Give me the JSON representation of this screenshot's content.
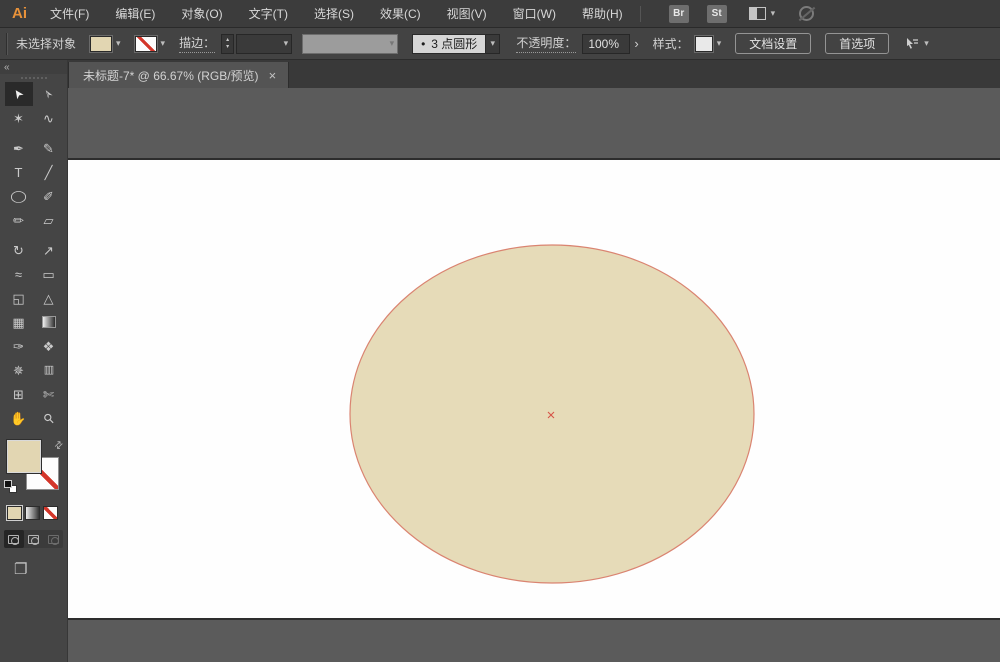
{
  "menu_bar": {
    "logo": "Ai",
    "items": [
      "文件(F)",
      "编辑(E)",
      "对象(O)",
      "文字(T)",
      "选择(S)",
      "效果(C)",
      "视图(V)",
      "窗口(W)",
      "帮助(H)"
    ],
    "bridge": "Br",
    "stock": "St"
  },
  "control_bar": {
    "status": "未选择对象",
    "fill_color": "#e2d6b2",
    "stroke_color": "none",
    "stroke_label": "描边：",
    "brush_bullet": "•",
    "brush_name": "3 点圆形",
    "opacity_label": "不透明度：",
    "opacity_value": "100%",
    "style_label": "样式：",
    "document_setup": "文档设置",
    "preferences": "首选项"
  },
  "tab": {
    "title": "未标题-7* @ 66.67% (RGB/预览)",
    "close": "×",
    "zoom_level": "66.67%",
    "color_mode": "RGB/预览"
  },
  "toolbar": {
    "collapse": "«",
    "tools": [
      {
        "name": "selection",
        "glyph": "➤",
        "active": true
      },
      {
        "name": "direct-selection",
        "glyph": "➢"
      },
      {
        "name": "magic-wand",
        "glyph": "✶"
      },
      {
        "name": "lasso",
        "glyph": "∿"
      },
      {
        "name": "pen",
        "glyph": "✒"
      },
      {
        "name": "curvature",
        "glyph": "✎"
      },
      {
        "name": "type",
        "glyph": "T"
      },
      {
        "name": "line-segment",
        "glyph": "╱"
      },
      {
        "name": "ellipse",
        "glyph": "◯"
      },
      {
        "name": "paintbrush",
        "glyph": "✐"
      },
      {
        "name": "pencil",
        "glyph": "✏"
      },
      {
        "name": "eraser",
        "glyph": "▱"
      },
      {
        "name": "rotate",
        "glyph": "↻"
      },
      {
        "name": "scale",
        "glyph": "↗"
      },
      {
        "name": "width",
        "glyph": "≈"
      },
      {
        "name": "free-transform",
        "glyph": "▭"
      },
      {
        "name": "shape-builder",
        "glyph": "◱"
      },
      {
        "name": "perspective-grid",
        "glyph": "△"
      },
      {
        "name": "mesh",
        "glyph": "▦"
      },
      {
        "name": "gradient",
        "glyph": ""
      },
      {
        "name": "eyedropper",
        "glyph": "✑"
      },
      {
        "name": "blend",
        "glyph": "❖"
      },
      {
        "name": "symbol-sprayer",
        "glyph": "✵"
      },
      {
        "name": "column-graph",
        "glyph": "▥"
      },
      {
        "name": "artboard",
        "glyph": "⊞"
      },
      {
        "name": "slice",
        "glyph": "✄"
      },
      {
        "name": "hand",
        "glyph": "✋"
      },
      {
        "name": "zoom",
        "glyph": "⚲"
      }
    ],
    "fill_color": "#e2d6b2",
    "stroke_color": "none"
  },
  "canvas": {
    "ellipse_fill": "#e6dbb8",
    "ellipse_stroke": "#da8471",
    "center_mark_color": "#d65548"
  },
  "ui": {
    "chevron": "▾",
    "stepper_up": "▴",
    "stepper_down": "▾",
    "panel_arrow": "›",
    "swap": "⇄",
    "screen_mode": "❐"
  }
}
